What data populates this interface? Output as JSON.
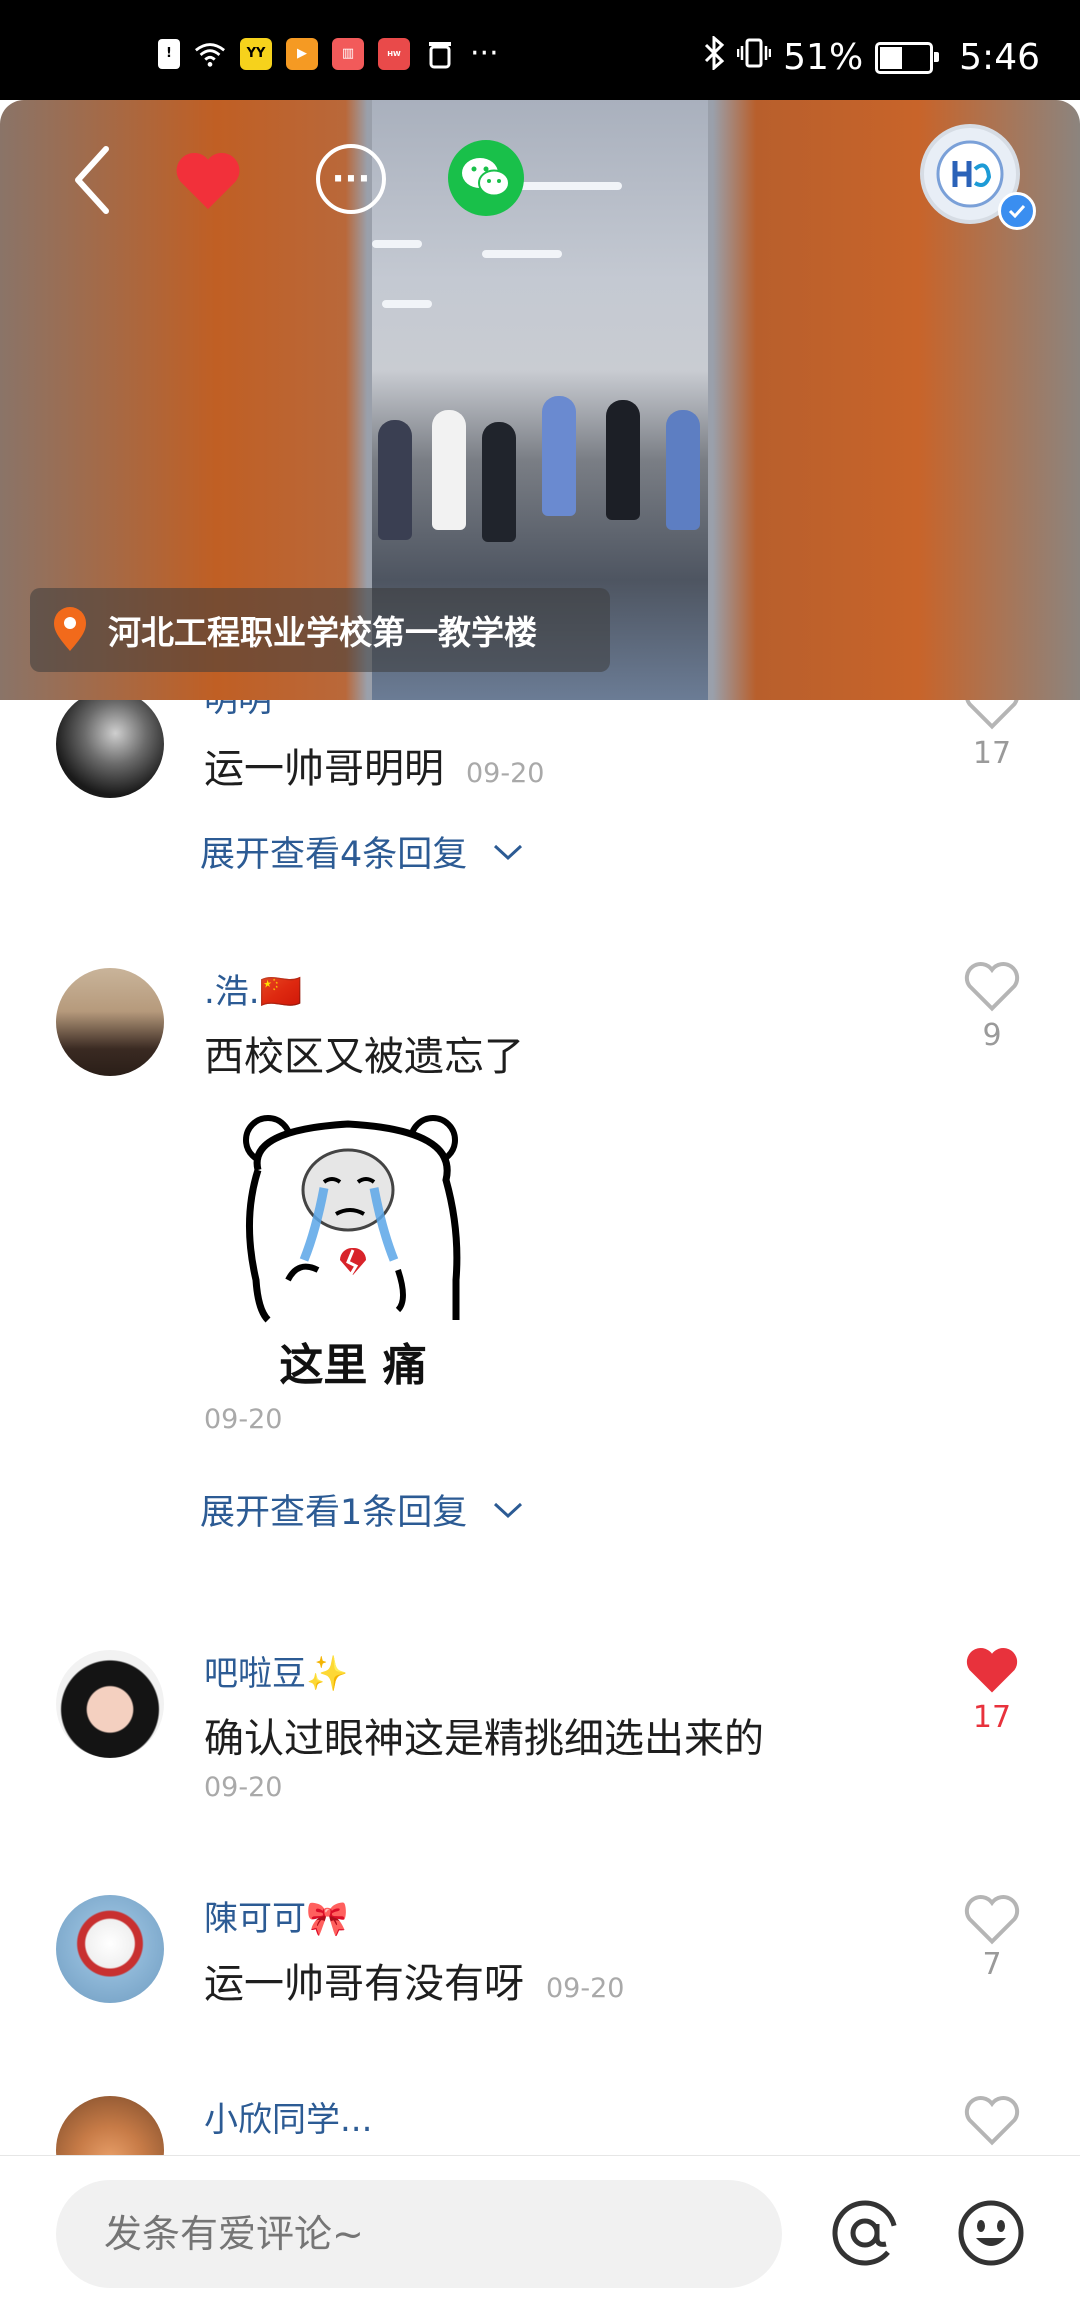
{
  "status_bar": {
    "battery_percent": "51%",
    "time": "5:46",
    "more": "···",
    "battery_level": 0.51
  },
  "header": {
    "location": "河北工程职业学校第一教学楼",
    "colors": {
      "like": "#f2303a",
      "wechat": "#19c04a",
      "verified": "#3a8ef0"
    },
    "icons": [
      "back-icon",
      "heart-icon",
      "more-icon",
      "wechat-icon",
      "avatar",
      "verified-icon"
    ]
  },
  "comments": [
    {
      "name": "明明",
      "text": "运一帅哥明明",
      "time": "09-20",
      "likes": "17",
      "liked": false,
      "expand": "展开查看4条回复"
    },
    {
      "name": ".浩.🇨🇳",
      "text": "西校区又被遗忘了",
      "time": "09-20",
      "likes": "9",
      "liked": false,
      "sticker_text": "这里  痛",
      "expand": "展开查看1条回复"
    },
    {
      "name": "吧啦豆✨",
      "text": "确认过眼神这是精挑细选出来的",
      "time": "09-20",
      "likes": "17",
      "liked": true
    },
    {
      "name": "陳可可🎀",
      "text": "运一帅哥有没有呀",
      "time": "09-20",
      "likes": "7",
      "liked": false
    },
    {
      "name": "小欣同学...",
      "liked": false
    }
  ],
  "bottom_bar": {
    "placeholder": "发条有爱评论~"
  }
}
